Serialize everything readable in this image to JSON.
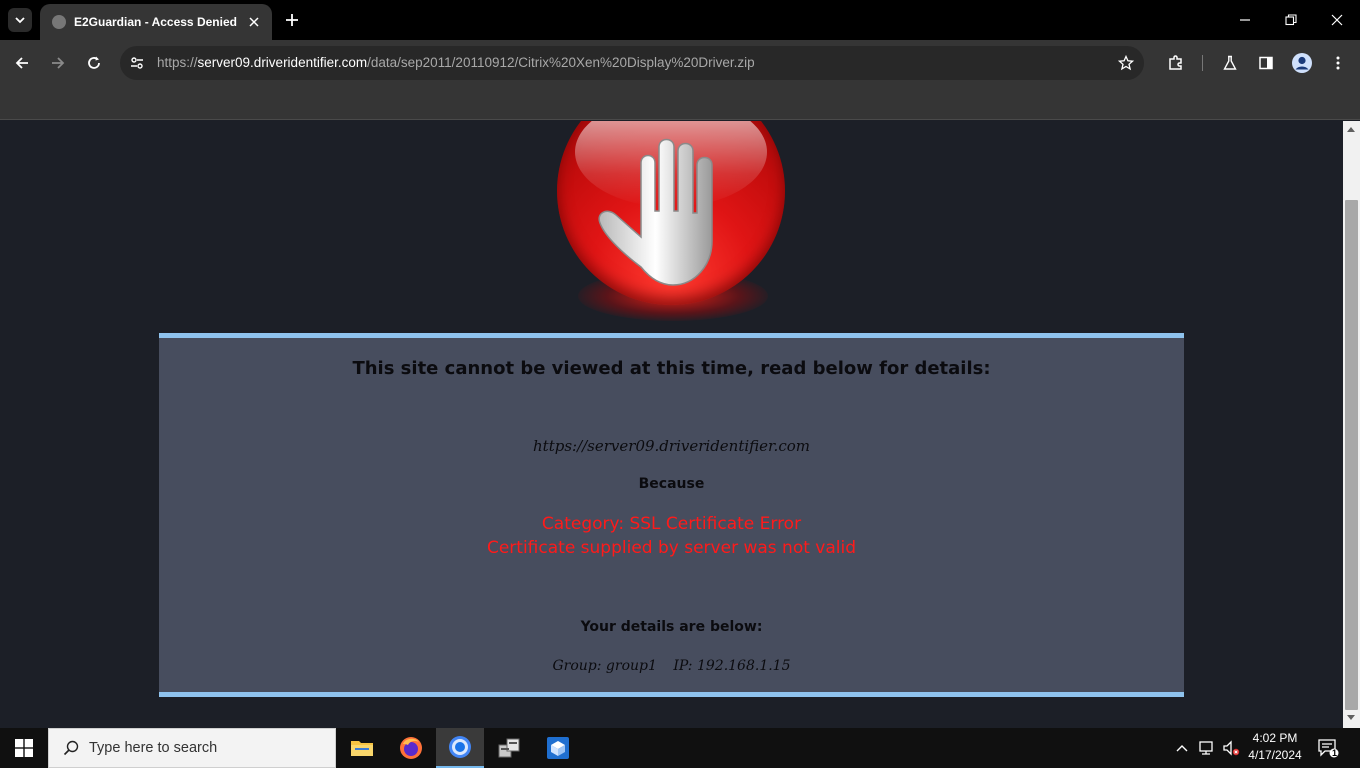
{
  "browser": {
    "tab_title": "E2Guardian - Access Denied",
    "url_scheme": "https://",
    "url_host": "server09.driveridentifier.com",
    "url_path": "/data/sep2011/20110912/Citrix%20Xen%20Display%20Driver.zip"
  },
  "page": {
    "heading": "This site cannot be viewed at this time, read below for details:",
    "site_url": "https://server09.driveridentifier.com",
    "because_label": "Because",
    "reason_category": "Category: SSL Certificate Error",
    "reason_detail": "Certificate supplied by server was not valid",
    "details_heading": "Your details are below:",
    "group_text": "Group: group1",
    "ip_text": "IP: 192.168.1.15",
    "colors": {
      "panel_bg": "#474d5e",
      "panel_border": "#8fc3ee",
      "error_red": "#ff1a1a",
      "page_bg": "#1c1f27"
    }
  },
  "taskbar": {
    "search_placeholder": "Type here to search",
    "time": "4:02 PM",
    "date": "4/17/2024",
    "notification_count": "1"
  }
}
